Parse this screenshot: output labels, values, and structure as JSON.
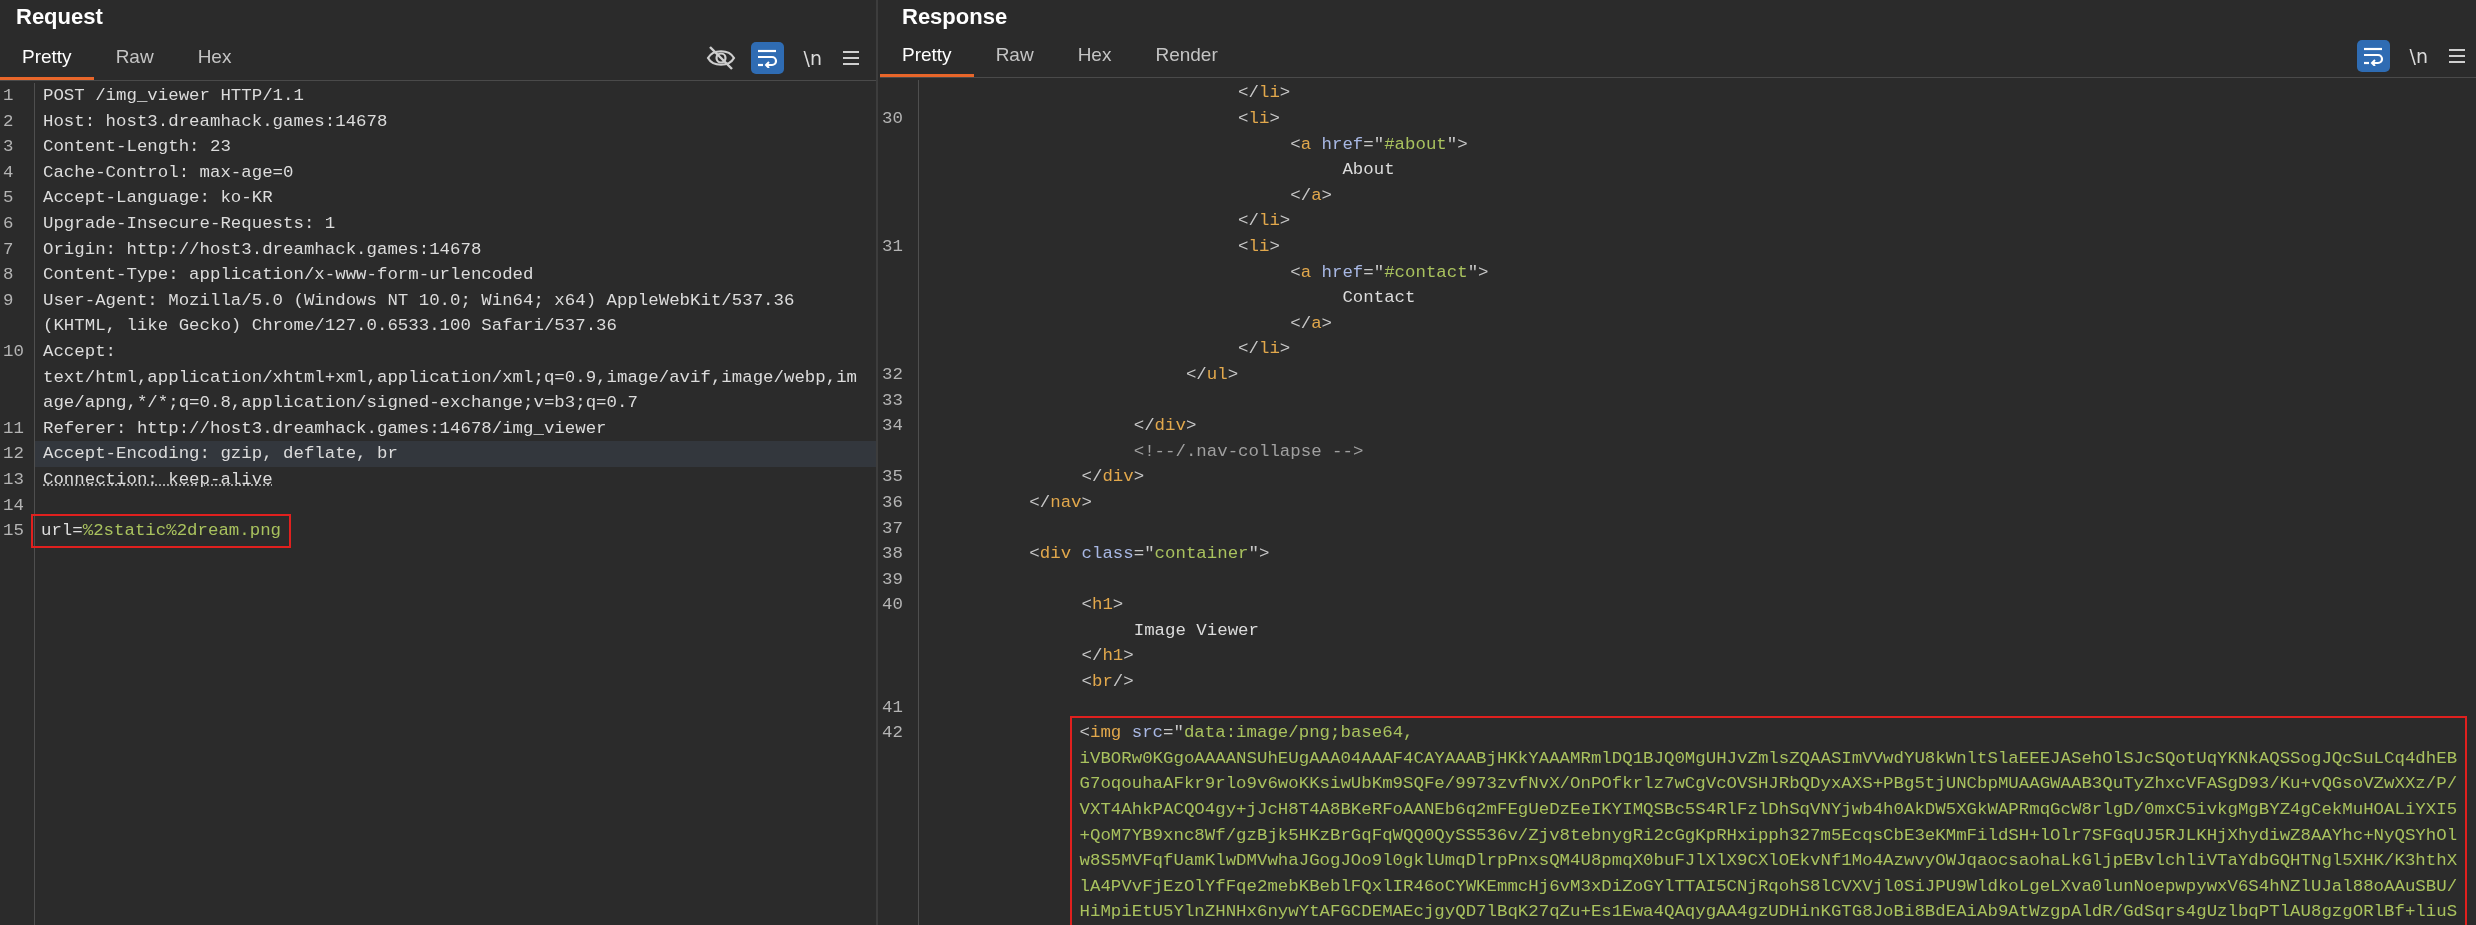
{
  "panels": [
    {
      "title": "Request",
      "tabs": [
        {
          "label": "Pretty",
          "selected": true
        },
        {
          "label": "Raw",
          "selected": false
        },
        {
          "label": "Hex",
          "selected": false
        }
      ],
      "hidden_chars_toggle": true,
      "wrap_on": true,
      "newline_label": "\\n",
      "rows": [
        {
          "number": "1",
          "selected": false,
          "boxed": false,
          "segments": [
            {
              "kind": "text",
              "text": "POST /img_viewer HTTP/1.1"
            }
          ]
        },
        {
          "number": "2",
          "selected": false,
          "boxed": false,
          "segments": [
            {
              "kind": "text",
              "text": "Host: host3.dreamhack.games:14678"
            }
          ]
        },
        {
          "number": "3",
          "selected": false,
          "boxed": false,
          "segments": [
            {
              "kind": "text",
              "text": "Content-Length: 23"
            }
          ]
        },
        {
          "number": "4",
          "selected": false,
          "boxed": false,
          "segments": [
            {
              "kind": "text",
              "text": "Cache-Control: max-age=0"
            }
          ]
        },
        {
          "number": "5",
          "selected": false,
          "boxed": false,
          "segments": [
            {
              "kind": "text",
              "text": "Accept-Language: ko-KR"
            }
          ]
        },
        {
          "number": "6",
          "selected": false,
          "boxed": false,
          "segments": [
            {
              "kind": "text",
              "text": "Upgrade-Insecure-Requests: 1"
            }
          ]
        },
        {
          "number": "7",
          "selected": false,
          "boxed": false,
          "segments": [
            {
              "kind": "text",
              "text": "Origin: http://host3.dreamhack.games:14678"
            }
          ]
        },
        {
          "number": "8",
          "selected": false,
          "boxed": false,
          "segments": [
            {
              "kind": "text",
              "text": "Content-Type: application/x-www-form-urlencoded"
            }
          ]
        },
        {
          "number": "9",
          "selected": false,
          "boxed": false,
          "segments": [
            {
              "kind": "text",
              "text": "User-Agent: Mozilla/5.0 (Windows NT 10.0; Win64; x64) AppleWebKit/537.36"
            }
          ]
        },
        {
          "selected": false,
          "boxed": false,
          "segments": [
            {
              "kind": "text",
              "text": "(KHTML, like Gecko) Chrome/127.0.6533.100 Safari/537.36"
            }
          ]
        },
        {
          "number": "10",
          "selected": false,
          "boxed": false,
          "segments": [
            {
              "kind": "text",
              "text": "Accept:"
            }
          ]
        },
        {
          "selected": false,
          "boxed": false,
          "segments": [
            {
              "kind": "text",
              "text": "text/html,application/xhtml+xml,application/xml;q=0.9,image/avif,image/webp,im"
            }
          ]
        },
        {
          "selected": false,
          "boxed": false,
          "segments": [
            {
              "kind": "text",
              "text": "age/apng,*/*;q=0.8,application/signed-exchange;v=b3;q=0.7"
            }
          ]
        },
        {
          "number": "11",
          "selected": false,
          "boxed": false,
          "segments": [
            {
              "kind": "text",
              "text": "Referer: http://host3.dreamhack.games:14678/img_viewer"
            }
          ]
        },
        {
          "number": "12",
          "selected": true,
          "boxed": false,
          "segments": [
            {
              "kind": "text",
              "text": "Accept-Encoding: gzip, deflate, br"
            }
          ]
        },
        {
          "number": "13",
          "selected": false,
          "boxed": false,
          "segments": [
            {
              "kind": "dotted",
              "text": "Connection: keep-alive"
            }
          ]
        },
        {
          "number": "14",
          "selected": false,
          "boxed": false
        },
        {
          "number": "15",
          "selected": false,
          "boxed": true,
          "segments": [
            {
              "kind": "text",
              "text": "url="
            },
            {
              "kind": "value",
              "text": "%2static%2dream.png"
            }
          ]
        }
      ]
    },
    {
      "title": "Response",
      "tabs": [
        {
          "label": "Pretty",
          "selected": true
        },
        {
          "label": "Raw",
          "selected": false
        },
        {
          "label": "Hex",
          "selected": false
        },
        {
          "label": "Render",
          "selected": false
        }
      ],
      "wrap_on": true,
      "newline_label": "\\n",
      "rows": [
        {
          "selected": false,
          "boxed": false,
          "segments": [
            {
              "kind": "punct",
              "text": "                              </"
            },
            {
              "kind": "tag",
              "text": "li"
            },
            {
              "kind": "punct",
              "text": ">"
            }
          ]
        },
        {
          "number": "30",
          "selected": false,
          "boxed": false,
          "segments": [
            {
              "kind": "punct",
              "text": "                              <"
            },
            {
              "kind": "tag",
              "text": "li"
            },
            {
              "kind": "punct",
              "text": ">"
            }
          ]
        },
        {
          "selected": false,
          "boxed": false,
          "segments": [
            {
              "kind": "punct",
              "text": "                                   <"
            },
            {
              "kind": "tag",
              "text": "a"
            },
            {
              "kind": "attr",
              "text": " href"
            },
            {
              "kind": "punct",
              "text": "=\""
            },
            {
              "kind": "value",
              "text": "#about"
            },
            {
              "kind": "punct",
              "text": "\">"
            }
          ]
        },
        {
          "selected": false,
          "boxed": false,
          "segments": [
            {
              "kind": "text",
              "text": "                                        About"
            }
          ]
        },
        {
          "selected": false,
          "boxed": false,
          "segments": [
            {
              "kind": "punct",
              "text": "                                   </"
            },
            {
              "kind": "tag",
              "text": "a"
            },
            {
              "kind": "punct",
              "text": ">"
            }
          ]
        },
        {
          "selected": false,
          "boxed": false,
          "segments": [
            {
              "kind": "punct",
              "text": "                              </"
            },
            {
              "kind": "tag",
              "text": "li"
            },
            {
              "kind": "punct",
              "text": ">"
            }
          ]
        },
        {
          "number": "31",
          "selected": false,
          "boxed": false,
          "segments": [
            {
              "kind": "punct",
              "text": "                              <"
            },
            {
              "kind": "tag",
              "text": "li"
            },
            {
              "kind": "punct",
              "text": ">"
            }
          ]
        },
        {
          "selected": false,
          "boxed": false,
          "segments": [
            {
              "kind": "punct",
              "text": "                                   <"
            },
            {
              "kind": "tag",
              "text": "a"
            },
            {
              "kind": "attr",
              "text": " href"
            },
            {
              "kind": "punct",
              "text": "=\""
            },
            {
              "kind": "value",
              "text": "#contact"
            },
            {
              "kind": "punct",
              "text": "\">"
            }
          ]
        },
        {
          "selected": false,
          "boxed": false,
          "segments": [
            {
              "kind": "text",
              "text": "                                        Contact"
            }
          ]
        },
        {
          "selected": false,
          "boxed": false,
          "segments": [
            {
              "kind": "punct",
              "text": "                                   </"
            },
            {
              "kind": "tag",
              "text": "a"
            },
            {
              "kind": "punct",
              "text": ">"
            }
          ]
        },
        {
          "selected": false,
          "boxed": false,
          "segments": [
            {
              "kind": "punct",
              "text": "                              </"
            },
            {
              "kind": "tag",
              "text": "li"
            },
            {
              "kind": "punct",
              "text": ">"
            }
          ]
        },
        {
          "number": "32",
          "selected": false,
          "boxed": false,
          "segments": [
            {
              "kind": "punct",
              "text": "                         </"
            },
            {
              "kind": "tag",
              "text": "ul"
            },
            {
              "kind": "punct",
              "text": ">"
            }
          ]
        },
        {
          "number": "33",
          "selected": false,
          "boxed": false
        },
        {
          "number": "34",
          "selected": false,
          "boxed": false,
          "segments": [
            {
              "kind": "punct",
              "text": "                    </"
            },
            {
              "kind": "tag",
              "text": "div"
            },
            {
              "kind": "punct",
              "text": ">"
            }
          ]
        },
        {
          "selected": false,
          "boxed": false,
          "segments": [
            {
              "kind": "comment",
              "text": "                    <!--/.nav-collapse -->"
            }
          ]
        },
        {
          "number": "35",
          "selected": false,
          "boxed": false,
          "segments": [
            {
              "kind": "punct",
              "text": "               </"
            },
            {
              "kind": "tag",
              "text": "div"
            },
            {
              "kind": "punct",
              "text": ">"
            }
          ]
        },
        {
          "number": "36",
          "selected": false,
          "boxed": false,
          "segments": [
            {
              "kind": "punct",
              "text": "          </"
            },
            {
              "kind": "tag",
              "text": "nav"
            },
            {
              "kind": "punct",
              "text": ">"
            }
          ]
        },
        {
          "number": "37",
          "selected": false,
          "boxed": false
        },
        {
          "number": "38",
          "selected": false,
          "boxed": false,
          "segments": [
            {
              "kind": "punct",
              "text": "          <"
            },
            {
              "kind": "tag",
              "text": "div"
            },
            {
              "kind": "attr",
              "text": " class"
            },
            {
              "kind": "punct",
              "text": "=\""
            },
            {
              "kind": "value",
              "text": "container"
            },
            {
              "kind": "punct",
              "text": "\">"
            }
          ]
        },
        {
          "number": "39",
          "selected": false,
          "boxed": false
        },
        {
          "number": "40",
          "selected": false,
          "boxed": false,
          "segments": [
            {
              "kind": "punct",
              "text": "               <"
            },
            {
              "kind": "tag",
              "text": "h1"
            },
            {
              "kind": "punct",
              "text": ">"
            }
          ]
        },
        {
          "selected": false,
          "boxed": false,
          "segments": [
            {
              "kind": "text",
              "text": "                    Image Viewer"
            }
          ]
        },
        {
          "selected": false,
          "boxed": false,
          "segments": [
            {
              "kind": "punct",
              "text": "               </"
            },
            {
              "kind": "tag",
              "text": "h1"
            },
            {
              "kind": "punct",
              "text": ">"
            }
          ]
        },
        {
          "selected": false,
          "boxed": false,
          "segments": [
            {
              "kind": "punct",
              "text": "               <"
            },
            {
              "kind": "tag",
              "text": "br"
            },
            {
              "kind": "punct",
              "text": "/>"
            }
          ]
        },
        {
          "number": "41",
          "selected": false,
          "boxed": false
        },
        {
          "number": "42",
          "selected": false,
          "boxed": true,
          "segments": [
            {
              "kind": "punct",
              "text": "               <"
            },
            {
              "kind": "tag",
              "text": "img"
            },
            {
              "kind": "attr",
              "text": " src"
            },
            {
              "kind": "punct",
              "text": "=\""
            },
            {
              "kind": "value",
              "text": "data:image/png;base64,"
            }
          ]
        },
        {
          "selected": false,
          "boxed": true,
          "segments": [
            {
              "kind": "value",
              "text": "               iVBORw0KGgoAAAANSUhEUgAAA04AAAF4CAYAAABjHKkYAAAMRmlDQ1BJQ0MgUHJvZmlsZQAASImVVwdYU8kWnltSlaEEEJASehOlSJcSQotUqYKNkAQSSogJQcSuLCq4dhEB"
            }
          ]
        },
        {
          "selected": false,
          "boxed": true,
          "segments": [
            {
              "kind": "value",
              "text": "               G7oqouhaAFkr9rlo9v6woKKsiwUbKm9SQFe/9973zvfNvX/OnPOfkrlz7wCgVcOVSHJRbQDyxAXS+PBg5tjUNCbpMUAAGWAAB3QuTyZhxcVFASgD93/Ku+vQGsoVZwXXz/P/"
            }
          ]
        },
        {
          "selected": false,
          "boxed": true,
          "segments": [
            {
              "kind": "value",
              "text": "               VXT4AhkPACQO4gy+jJcH8T4A8BKeRFoAANEb6q2mFEgUeDzEeIKYIMQSBc5S4RlFzlDhSqVNYjwb4h0AkDW5XGkWAPRmqGcW8rlgD/0mxC5ivkgMgBYZ4gCekMuHOALiYXI5"
            }
          ]
        },
        {
          "selected": false,
          "boxed": true,
          "segments": [
            {
              "kind": "value",
              "text": "               +QoM7YB9xnc8Wf/gzBjk5HKzBrGqFqWQQ0QySS536v/Zjv8tebnygRi2cGgKpRHxipph327m5EcqsCbE3eKMmFildSH+lOlr7SFGqUJ5RJLKHjXhydiwZ8AAYhc+NyQSYhOl"
            }
          ]
        },
        {
          "selected": false,
          "boxed": true,
          "segments": [
            {
              "kind": "value",
              "text": "               w8S5MVFqfUamKlwDMVwhaJGogJOo9l0gklUmqDlrpPnxsQM4U8pmqX0buFJlXlX9CXlOEkvNf1Mo4AzwvyOWJqaocsaohaLkGljpEBvlchliVTaYdbGQHTNgl5XHK/K3hthX"
            }
          ]
        },
        {
          "selected": false,
          "boxed": true,
          "segments": [
            {
              "kind": "value",
              "text": "               lA4PVvFjEzOlYfFqe2mebKBeblFQxlIR46oCYWKEmmcHj6vM3xDiZoGYlTTAI5CNjRqohS8lCVXVjl0SiJPU9WldkoLgeLXva0lunNoepwpywxV6S4hNZlUJal88oAAuSBU/"
            }
          ]
        },
        {
          "selected": false,
          "boxed": true,
          "segments": [
            {
              "kind": "value",
              "text": "               HiMpiEtU5YlnZHNHx6nywYtAFGCDEMAEcjgyQD7lBqK27qZu+Es1Ewa4QAqygAA4gzUDHinKGTG8JoBi8BdEAiAb9AtWzgpAldR/GdSqrs4gUzlbqPTlAU8gzgORlBf+liuS"
            }
          ]
        }
      ]
    }
  ]
}
